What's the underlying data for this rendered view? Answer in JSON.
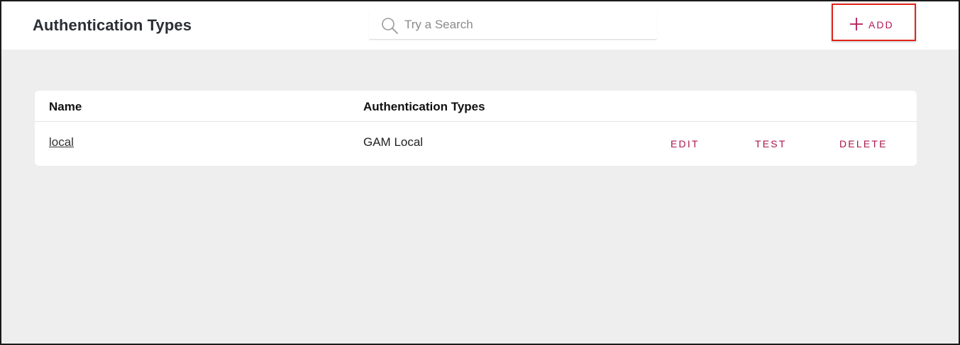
{
  "header": {
    "title": "Authentication Types",
    "search": {
      "placeholder": "Try a Search",
      "value": ""
    },
    "add_label": "ADD"
  },
  "table": {
    "columns": [
      "Name",
      "Authentication Types"
    ],
    "rows": [
      {
        "name": "local",
        "type": "GAM Local",
        "actions": [
          "EDIT",
          "TEST",
          "DELETE"
        ]
      }
    ]
  },
  "colors": {
    "accent": "#a8174f",
    "highlight_border": "#e0241b",
    "background": "#eeeeee"
  },
  "icons": {
    "search": "search-icon",
    "add": "plus-icon"
  }
}
